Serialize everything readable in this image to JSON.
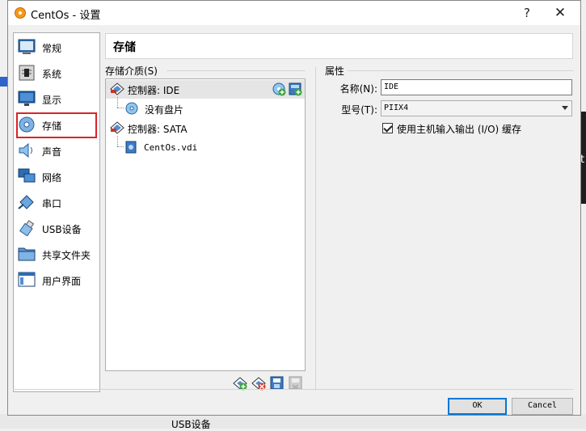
{
  "window": {
    "title": "CentOs - 设置",
    "help_glyph": "?",
    "close_glyph": "✕"
  },
  "nav": {
    "items": [
      {
        "label": "常规",
        "icon": "general-icon"
      },
      {
        "label": "系统",
        "icon": "system-chip-icon"
      },
      {
        "label": "显示",
        "icon": "display-monitor-icon"
      },
      {
        "label": "存储",
        "icon": "storage-disk-icon",
        "selected": true
      },
      {
        "label": "声音",
        "icon": "speaker-icon"
      },
      {
        "label": "网络",
        "icon": "network-icon"
      },
      {
        "label": "串口",
        "icon": "serial-port-icon"
      },
      {
        "label": "USB设备",
        "icon": "usb-icon"
      },
      {
        "label": "共享文件夹",
        "icon": "shared-folder-icon"
      },
      {
        "label": "用户界面",
        "icon": "user-interface-icon"
      }
    ]
  },
  "page": {
    "title": "存储"
  },
  "storage": {
    "group_label": "存储介质(S)",
    "tree": [
      {
        "label": "控制器: IDE",
        "type": "controller",
        "selected": true
      },
      {
        "label": "没有盘片",
        "type": "optical-empty"
      },
      {
        "label": "控制器: SATA",
        "type": "controller"
      },
      {
        "label": "CentOs.vdi",
        "type": "hard-disk"
      }
    ]
  },
  "attributes": {
    "group_label": "属性",
    "name_label": "名称(N):",
    "name_value": "IDE",
    "type_label": "型号(T):",
    "type_value": "PIIX4",
    "cache_label": "使用主机输入输出 (I/O) 缓存",
    "cache_checked": true
  },
  "buttons": {
    "ok": "OK",
    "cancel": "Cancel"
  },
  "background": {
    "bottom_text": "USB设备",
    "side_char": "t"
  },
  "colors": {
    "selection_outline": "#d8232a",
    "focus_blue": "#0078d7"
  }
}
